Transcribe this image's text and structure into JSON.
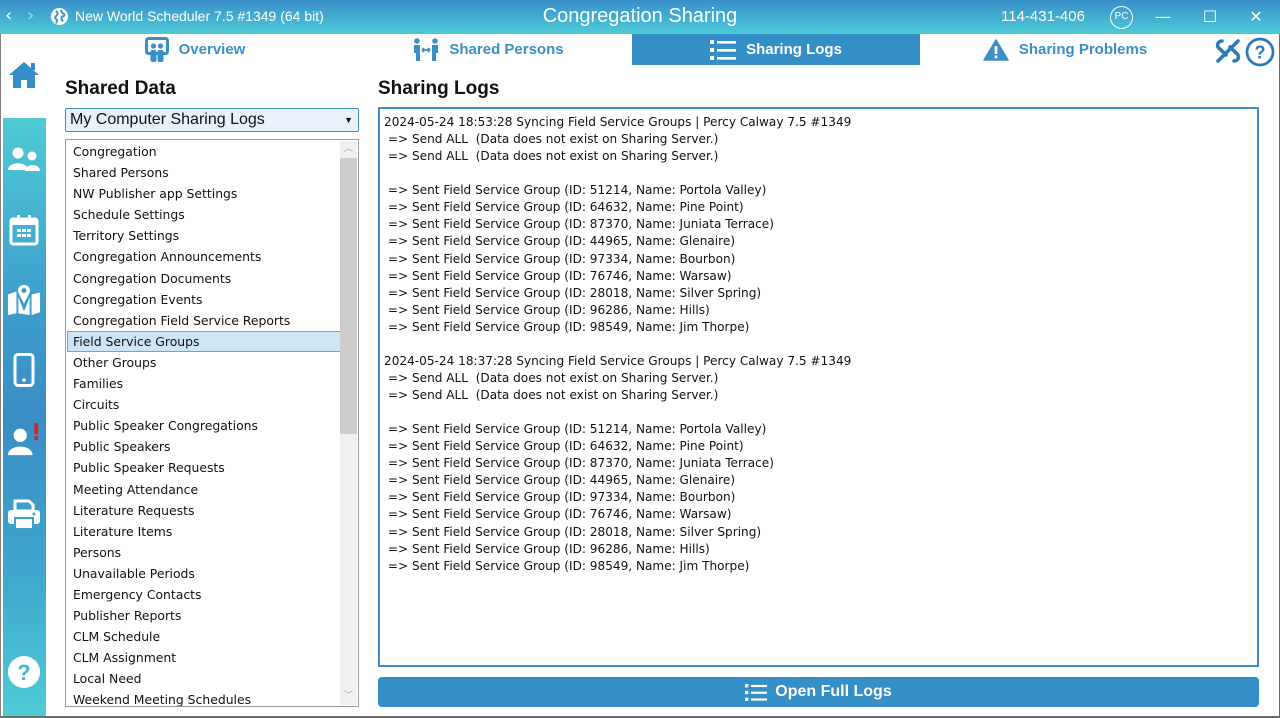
{
  "titlebar": {
    "app_title": "New World Scheduler 7.5 #1349 (64 bit)",
    "window_title": "Congregation Sharing",
    "congregation_id": "114-431-406",
    "user_initials": "PC",
    "back_icon": "‹",
    "forward_icon": "›",
    "minimize": "—",
    "maximize": "☐",
    "close": "✕"
  },
  "tabs": [
    {
      "label": "Overview",
      "icon": "overview-icon",
      "active": false
    },
    {
      "label": "Shared Persons",
      "icon": "shared-persons-icon",
      "active": false
    },
    {
      "label": "Sharing Logs",
      "icon": "list-icon",
      "active": true
    },
    {
      "label": "Sharing Problems",
      "icon": "warning-icon",
      "active": false
    }
  ],
  "sidebar": {
    "items": [
      "home",
      "people",
      "calendar",
      "territory-map",
      "mobile",
      "person-alert",
      "print",
      "help"
    ]
  },
  "left_panel": {
    "heading": "Shared Data",
    "select_value": "My Computer Sharing Logs",
    "selected_item": "Field Service Groups",
    "items": [
      "Congregation",
      "Shared Persons",
      "NW Publisher app Settings",
      "Schedule Settings",
      "Territory Settings",
      "Congregation Announcements",
      "Congregation Documents",
      "Congregation Events",
      "Congregation Field Service Reports",
      "Field Service Groups",
      "Other Groups",
      "Families",
      "Circuits",
      "Public Speaker Congregations",
      "Public Speakers",
      "Public Speaker Requests",
      "Meeting Attendance",
      "Literature Requests",
      "Literature Items",
      "Persons",
      "Unavailable Periods",
      "Emergency Contacts",
      "Publisher Reports",
      "CLM Schedule",
      "CLM Assignment",
      "Local Need",
      "Weekend Meeting Schedules"
    ]
  },
  "right_panel": {
    "heading": "Sharing Logs",
    "log_lines": [
      "2024-05-24 18:53:28 Syncing Field Service Groups | Percy Calway 7.5 #1349",
      " => Send ALL  (Data does not exist on Sharing Server.)",
      " => Send ALL  (Data does not exist on Sharing Server.)",
      "",
      " => Sent Field Service Group (ID: 51214, Name: Portola Valley)",
      " => Sent Field Service Group (ID: 64632, Name: Pine Point)",
      " => Sent Field Service Group (ID: 87370, Name: Juniata Terrace)",
      " => Sent Field Service Group (ID: 44965, Name: Glenaire)",
      " => Sent Field Service Group (ID: 97334, Name: Bourbon)",
      " => Sent Field Service Group (ID: 76746, Name: Warsaw)",
      " => Sent Field Service Group (ID: 28018, Name: Silver Spring)",
      " => Sent Field Service Group (ID: 96286, Name: Hills)",
      " => Sent Field Service Group (ID: 98549, Name: Jim Thorpe)",
      "",
      "2024-05-24 18:37:28 Syncing Field Service Groups | Percy Calway 7.5 #1349",
      " => Send ALL  (Data does not exist on Sharing Server.)",
      " => Send ALL  (Data does not exist on Sharing Server.)",
      "",
      " => Sent Field Service Group (ID: 51214, Name: Portola Valley)",
      " => Sent Field Service Group (ID: 64632, Name: Pine Point)",
      " => Sent Field Service Group (ID: 87370, Name: Juniata Terrace)",
      " => Sent Field Service Group (ID: 44965, Name: Glenaire)",
      " => Sent Field Service Group (ID: 97334, Name: Bourbon)",
      " => Sent Field Service Group (ID: 76746, Name: Warsaw)",
      " => Sent Field Service Group (ID: 28018, Name: Silver Spring)",
      " => Sent Field Service Group (ID: 96286, Name: Hills)",
      " => Sent Field Service Group (ID: 98549, Name: Jim Thorpe)"
    ],
    "open_button_label": "Open Full Logs"
  },
  "colors": {
    "accent": "#338fc6",
    "titlebar_top": "#3a8fc8",
    "titlebar_bottom": "#4fcbd5",
    "selection": "#cde6f7",
    "alert": "#e0201c"
  }
}
